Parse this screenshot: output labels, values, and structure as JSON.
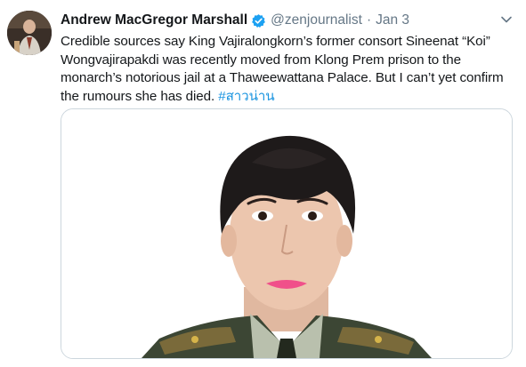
{
  "tweet": {
    "author_name": "Andrew MacGregor Marshall",
    "handle": "@zenjournalist",
    "separator": "·",
    "date": "Jan 3",
    "text": "Credible sources say King Vajiralongkorn’s former consort Sineenat “Koi” Wongvajirapakdi was recently moved from Klong Prem prison to the monarch’s notorious jail at a Thaweewattana Palace. But I can’t yet confirm the rumours she has died. ",
    "hashtag": "#สาวน่าน"
  },
  "colors": {
    "verified_blue": "#1da1f2",
    "hashtag_blue": "#1b95e0",
    "secondary_text": "#657786"
  },
  "icons": {
    "verified": "verified-badge-icon",
    "menu": "chevron-down-icon"
  }
}
